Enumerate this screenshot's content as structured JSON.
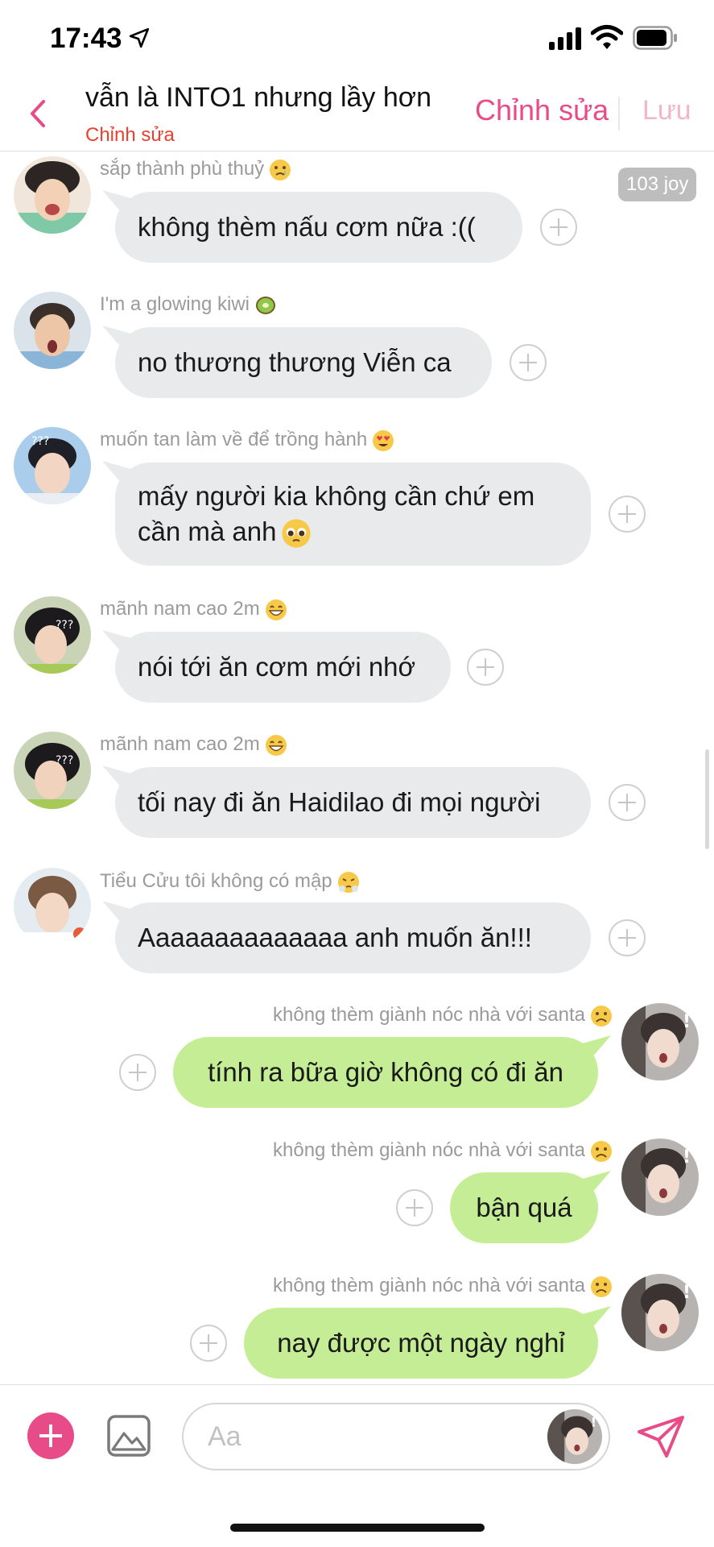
{
  "status_bar": {
    "time": "17:43"
  },
  "header": {
    "title": "vẫn là INTO1 nhưng lầy hơn",
    "subtitle": "Chỉnh sửa",
    "edit_label": "Chỉnh sửa",
    "save_label": "Lưu"
  },
  "badge": {
    "text": "103 joy"
  },
  "messages": [
    {
      "sender": "sắp thành phù thuỷ",
      "sender_emoji": "crying-face",
      "text": "không thèm nấu cơm nữa :((",
      "side": "incoming"
    },
    {
      "sender": "I'm a glowing kiwi",
      "sender_emoji": "kiwi-fruit",
      "text": "no thương thương Viễn ca",
      "side": "incoming"
    },
    {
      "sender": "muốn tan làm về để trồng hành",
      "sender_emoji": "heart-eyes",
      "text_line1": "mấy người kia không cần chứ em",
      "text_line2": "cần mà anh",
      "text_emoji": "pleading-face",
      "side": "incoming"
    },
    {
      "sender": "mãnh nam cao 2m",
      "sender_emoji": "grinning-face",
      "text": "nói tới ăn cơm mới nhớ",
      "side": "incoming"
    },
    {
      "sender": "mãnh nam cao 2m",
      "sender_emoji": "grinning-face",
      "text": "tối nay đi ăn Haidilao đi mọi người",
      "side": "incoming"
    },
    {
      "sender": "Tiểu Cửu tôi không có mập",
      "sender_emoji": "steam-nose-face",
      "text": "Aaaaaaaaaaaaaa anh muốn ăn!!!",
      "side": "incoming"
    },
    {
      "sender": "không thèm giành nóc nhà với santa",
      "sender_emoji": "frowning-face",
      "text": "tính ra bữa giờ không có đi ăn",
      "side": "outgoing"
    },
    {
      "sender": "không thèm giành nóc nhà với santa",
      "sender_emoji": "frowning-face",
      "text": "bận quá",
      "side": "outgoing"
    },
    {
      "sender": "không thèm giành nóc nhà với santa",
      "sender_emoji": "frowning-face",
      "text": "nay được một ngày nghỉ",
      "side": "outgoing"
    }
  ],
  "composer": {
    "placeholder": "Aa"
  },
  "colors": {
    "accent": "#e84c88",
    "outgoing_bubble": "#c5ed95",
    "incoming_bubble": "#e9eaeb",
    "subtitle": "#e8412f"
  }
}
